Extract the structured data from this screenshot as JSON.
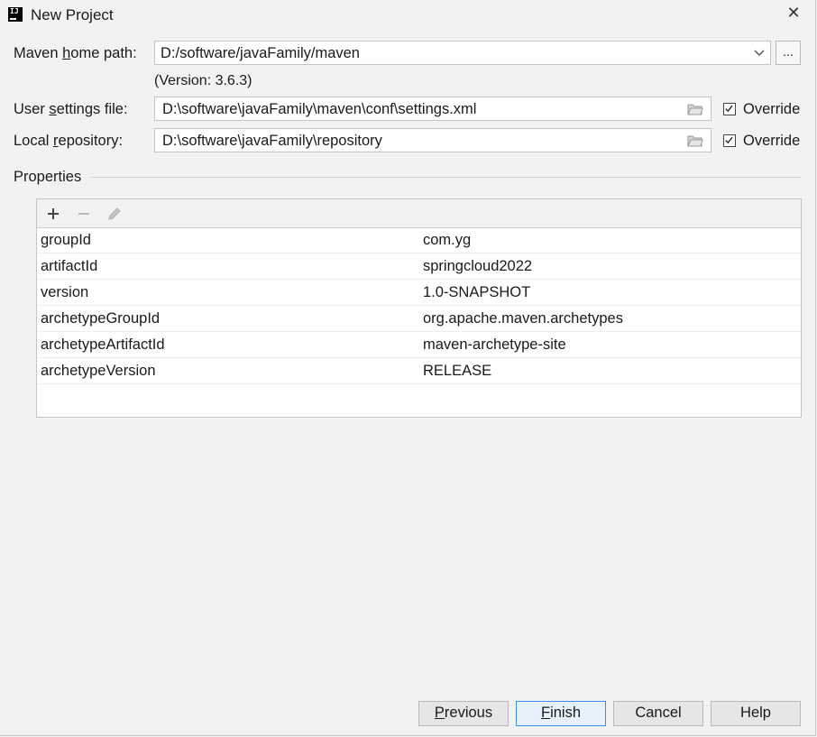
{
  "window": {
    "title": "New Project",
    "close_symbol": "✕",
    "app_icon": "intellij-idea-icon",
    "app_icon_text": "IJ"
  },
  "maven": {
    "home_label_pre": "Maven ",
    "home_label_mnemonic": "h",
    "home_label_post": "ome path:",
    "home_value": "D:/software/javaFamily/maven",
    "browse_label": "...",
    "version_text": "(Version: 3.6.3)"
  },
  "user_settings": {
    "label_pre": "User ",
    "label_mnemonic": "s",
    "label_post": "ettings file:",
    "value": "D:\\software\\javaFamily\\maven\\conf\\settings.xml",
    "override_label": "Override",
    "override_checked": true
  },
  "local_repo": {
    "label_pre": "Local ",
    "label_mnemonic": "r",
    "label_post": "epository:",
    "value": "D:\\software\\javaFamily\\repository",
    "override_label": "Override",
    "override_checked": true
  },
  "properties": {
    "title": "Properties",
    "toolbar": [
      "add-icon",
      "remove-icon",
      "edit-icon"
    ],
    "rows": [
      {
        "key": "groupId",
        "value": "com.yg"
      },
      {
        "key": "artifactId",
        "value": "springcloud2022"
      },
      {
        "key": "version",
        "value": "1.0-SNAPSHOT"
      },
      {
        "key": "archetypeGroupId",
        "value": "org.apache.maven.archetypes"
      },
      {
        "key": "archetypeArtifactId",
        "value": "maven-archetype-site"
      },
      {
        "key": "archetypeVersion",
        "value": "RELEASE"
      }
    ]
  },
  "buttons": {
    "previous_mnemonic": "P",
    "previous_rest": "revious",
    "finish_mnemonic": "F",
    "finish_rest": "inish",
    "cancel": "Cancel",
    "help": "Help"
  },
  "colors": {
    "default_button_border": "#3a8ee6",
    "default_button_bg": "#e6f1fb",
    "dialog_bg": "#f2f2f2"
  }
}
